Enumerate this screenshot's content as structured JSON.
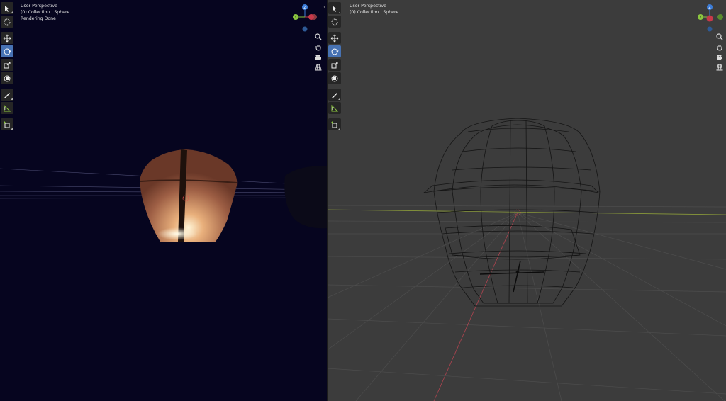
{
  "viewports": [
    {
      "id": "left",
      "mode": "rendered",
      "background": "#06051f",
      "info": {
        "view_name": "User Perspective",
        "collection": "(0) Collection | Sphere",
        "status": "Rendering Done"
      }
    },
    {
      "id": "right",
      "mode": "wireframe",
      "background": "#3c3c3c",
      "info": {
        "view_name": "User Perspective",
        "collection": "(0) Collection | Sphere"
      }
    }
  ],
  "toolbar": {
    "tools": [
      "select-box",
      "cursor",
      "move",
      "rotate",
      "scale",
      "transform",
      "annotate",
      "measure",
      "add-cube"
    ],
    "active_tool": "rotate"
  },
  "nav_gizmo": {
    "axes": [
      "X",
      "Y",
      "Z"
    ],
    "axis_colors": {
      "x": "#c8394a",
      "y": "#8bc63f",
      "z": "#3d7dd8"
    },
    "buttons": [
      "zoom",
      "pan",
      "camera",
      "perspective-grid"
    ]
  },
  "colors": {
    "lantern": "#a0644c",
    "lantern_glow": "#fff4d6",
    "active_tool": "#4772b3",
    "origin_marker": "#e05050"
  }
}
